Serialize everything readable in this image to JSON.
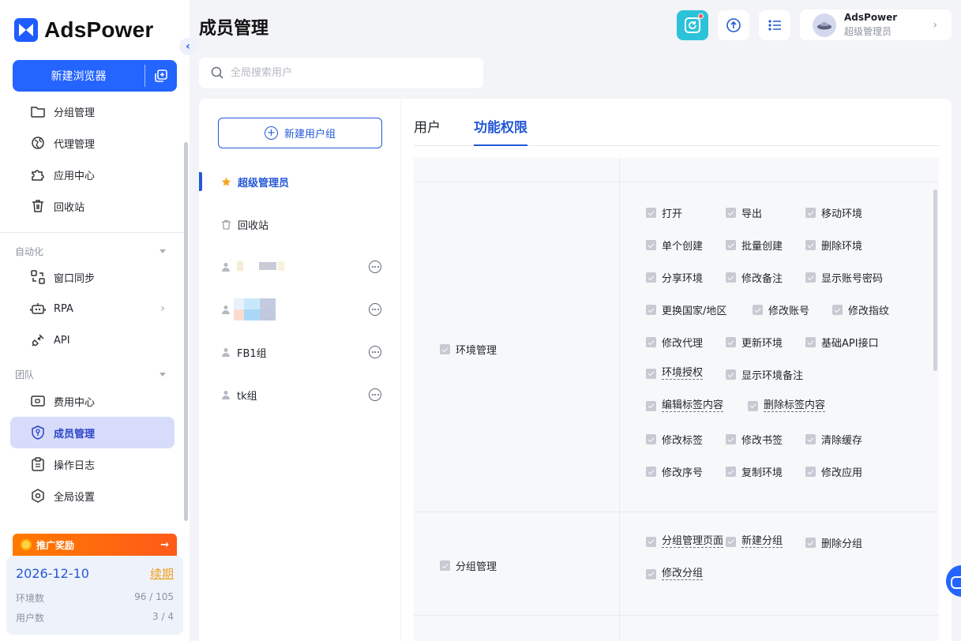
{
  "app": {
    "brand": "AdsPower",
    "page_title": "成员管理"
  },
  "sidebar": {
    "new_browser_label": "新建浏览器",
    "items_top": [
      {
        "label": "分组管理",
        "icon": "folder-icon"
      },
      {
        "label": "代理管理",
        "icon": "proxy-globe-icon"
      },
      {
        "label": "应用中心",
        "icon": "puzzle-icon"
      },
      {
        "label": "回收站",
        "icon": "trash-icon"
      }
    ],
    "section_automation": "自动化",
    "items_automation": [
      {
        "label": "窗口同步",
        "icon": "window-sync-icon"
      },
      {
        "label": "RPA",
        "icon": "robot-icon"
      },
      {
        "label": "API",
        "icon": "plug-icon"
      }
    ],
    "section_team": "团队",
    "items_team": [
      {
        "label": "费用中心",
        "icon": "wallet-icon"
      },
      {
        "label": "成员管理",
        "icon": "shield-key-icon",
        "active": true
      },
      {
        "label": "操作日志",
        "icon": "clipboard-icon"
      },
      {
        "label": "全局设置",
        "icon": "settings-hexagon-icon"
      }
    ],
    "promo": {
      "label": "推广奖励",
      "arrow": "→"
    },
    "plan": {
      "expiry": "2026-12-10",
      "renew_label": "续期",
      "env_label": "环境数",
      "env_value": "96 / 105",
      "user_label": "用户数",
      "user_value": "3 / 4"
    }
  },
  "header": {
    "profile_name": "AdsPower",
    "profile_role": "超级管理员"
  },
  "search": {
    "placeholder": "全局搜索用户"
  },
  "groups": {
    "new_group_label": "新建用户组",
    "items": [
      {
        "label": "超级管理员",
        "icon": "star-icon",
        "active": true
      },
      {
        "label": "回收站",
        "icon": "trash-icon"
      },
      {
        "label": "",
        "icon": "user-icon",
        "blurred": true
      },
      {
        "label": "",
        "icon": "user-icon",
        "blurred": true
      },
      {
        "label": "FB1组",
        "icon": "user-icon"
      },
      {
        "label": "tk组",
        "icon": "user-icon"
      }
    ]
  },
  "permissions": {
    "tabs": [
      {
        "label": "用户",
        "active": false
      },
      {
        "label": "功能权限",
        "active": true
      }
    ],
    "categories": [
      {
        "name": "环境管理",
        "options": [
          [
            "打开",
            "导出",
            "移动环境"
          ],
          [
            "单个创建",
            "批量创建",
            "删除环境"
          ],
          [
            "分享环境",
            "修改备注",
            "显示账号密码"
          ],
          [
            "更换国家/地区",
            "修改账号",
            "修改指纹"
          ],
          [
            "修改代理",
            "更新环境",
            "基础API接口"
          ],
          [
            "环境授权",
            "显示环境备注"
          ],
          [
            "编辑标签内容",
            "删除标签内容"
          ],
          [
            "修改标签",
            "修改书签",
            "清除缓存"
          ],
          [
            "修改序号",
            "复制环境",
            "修改应用"
          ]
        ]
      },
      {
        "name": "分组管理",
        "options": [
          [
            "分组管理页面",
            "新建分组",
            "删除分组"
          ],
          [
            "修改分组"
          ]
        ]
      }
    ]
  },
  "colors": {
    "primary": "#2464ff",
    "active_nav_bg": "#d6dcfa",
    "promo_orange": "#ff6a10",
    "renew": "#f0a020"
  }
}
